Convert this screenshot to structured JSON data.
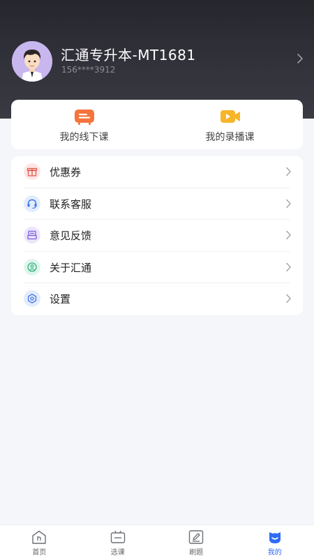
{
  "profile": {
    "name": "汇通专升本-MT1681",
    "phone": "156****3912"
  },
  "courses": {
    "offline_label": "我的线下课",
    "recorded_label": "我的录播课"
  },
  "menu": {
    "items": [
      {
        "label": "优惠券",
        "icon": "gift-icon"
      },
      {
        "label": "联系客服",
        "icon": "headset-icon"
      },
      {
        "label": "意见反馈",
        "icon": "feedback-icon"
      },
      {
        "label": "关于汇通",
        "icon": "user-circle-icon"
      },
      {
        "label": "设置",
        "icon": "settings-icon"
      }
    ]
  },
  "tabs": [
    {
      "label": "首页",
      "icon": "home-icon"
    },
    {
      "label": "选课",
      "icon": "course-select-icon"
    },
    {
      "label": "刷题",
      "icon": "edit-icon"
    },
    {
      "label": "我的",
      "icon": "profile-icon",
      "active": true
    }
  ],
  "colors": {
    "accent": "#2f6bf5",
    "header_bg": "#2b2b33",
    "offline_icon": "#f4743b",
    "recorded_icon": "#f7b52a"
  }
}
